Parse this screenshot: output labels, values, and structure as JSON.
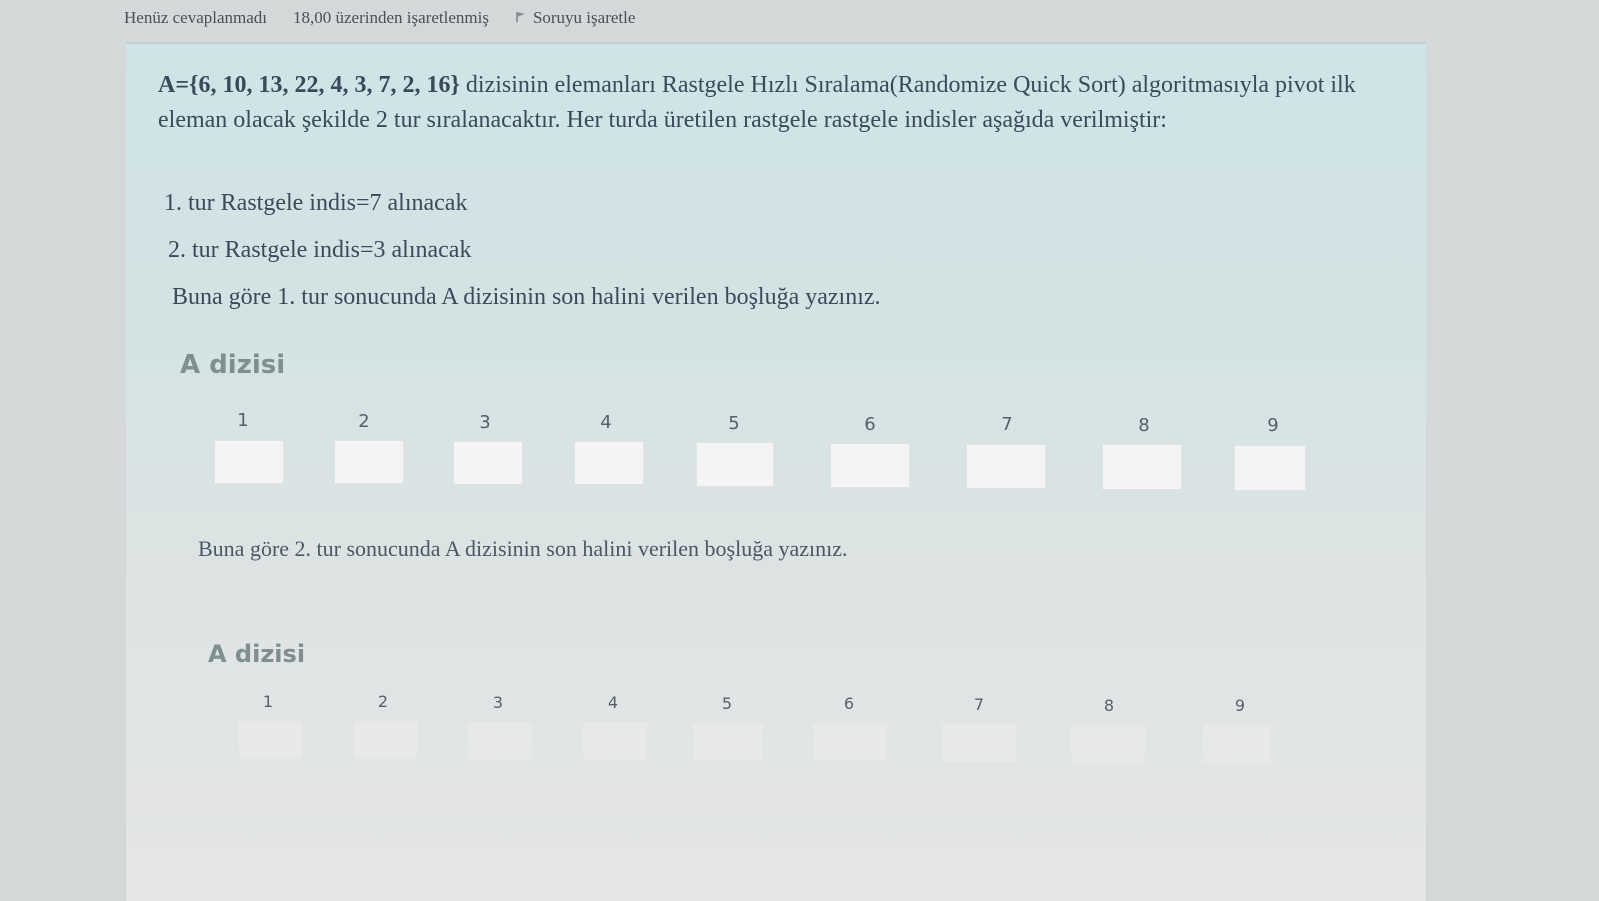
{
  "status": {
    "answered": "Henüz cevaplanmadı",
    "marks": "18,00 üzerinden işaretlenmiş",
    "flag_label": "Soruyu işaretle"
  },
  "question": {
    "array_literal": "A={6, 10, 13, 22, 4, 3, 7, 2, 16}",
    "intro_rest": " dizisinin elemanları Rastgele Hızlı Sıralama(Randomize Quick Sort) algoritmasıyla pivot ilk eleman olacak şekilde 2 tur sıralanacaktır. Her turda üretilen rastgele rastgele indisler aşağıda verilmiştir:",
    "step1": "1. tur Rastgele indis=7 alınacak",
    "step2": "2. tur Rastgele indis=3 alınacak",
    "prompt1": "Buna göre 1. tur sonucunda A dizisinin son halini verilen boşluğa yazınız.",
    "prompt2": "Buna göre 2. tur sonucunda A dizisinin son halini verilen boşluğa yazınız."
  },
  "table1": {
    "heading": "A dizisi",
    "columns": [
      "1",
      "2",
      "3",
      "4",
      "5",
      "6",
      "7",
      "8",
      "9"
    ],
    "values": [
      "",
      "",
      "",
      "",
      "",
      "",
      "",
      "",
      ""
    ]
  },
  "table2": {
    "heading": "A dizisi",
    "columns": [
      "1",
      "2",
      "3",
      "4",
      "5",
      "6",
      "7",
      "8",
      "9"
    ],
    "values": [
      "",
      "",
      "",
      "",
      "",
      "",
      "",
      "",
      ""
    ]
  }
}
